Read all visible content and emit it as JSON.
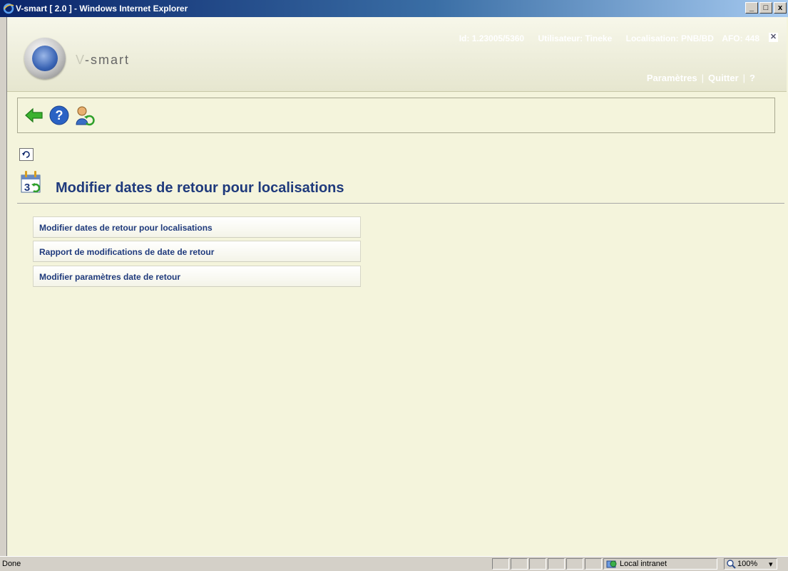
{
  "window": {
    "title": "V-smart [ 2.0 ] - Windows Internet Explorer",
    "minimize": "_",
    "maximize": "□",
    "close": "x"
  },
  "header": {
    "logo_prefix": "V",
    "logo_suffix": "-smart",
    "id": "Id: 1.23005/5360",
    "user": "Utilisateur: Tineke",
    "location": "Localisation: PNB/BD",
    "afo": "AFO: 448",
    "close": "✕",
    "links": {
      "params": "Paramètres",
      "quit": "Quitter",
      "help": "?"
    }
  },
  "toolbar": {
    "icons": [
      "back-arrow-icon",
      "help-icon",
      "user-refresh-icon"
    ]
  },
  "page": {
    "title": "Modifier dates de retour pour localisations"
  },
  "menu": {
    "items": [
      {
        "label": "Modifier dates de retour pour localisations"
      },
      {
        "label": "Rapport de modifications de date de retour"
      },
      {
        "label": "Modifier paramètres date de retour"
      }
    ]
  },
  "statusbar": {
    "status": "Done",
    "zone": "Local intranet",
    "zoom": "100%"
  },
  "colors": {
    "background": "#f4f4dc",
    "heading": "#1f3a7c",
    "titlebar": "#0a246a"
  }
}
